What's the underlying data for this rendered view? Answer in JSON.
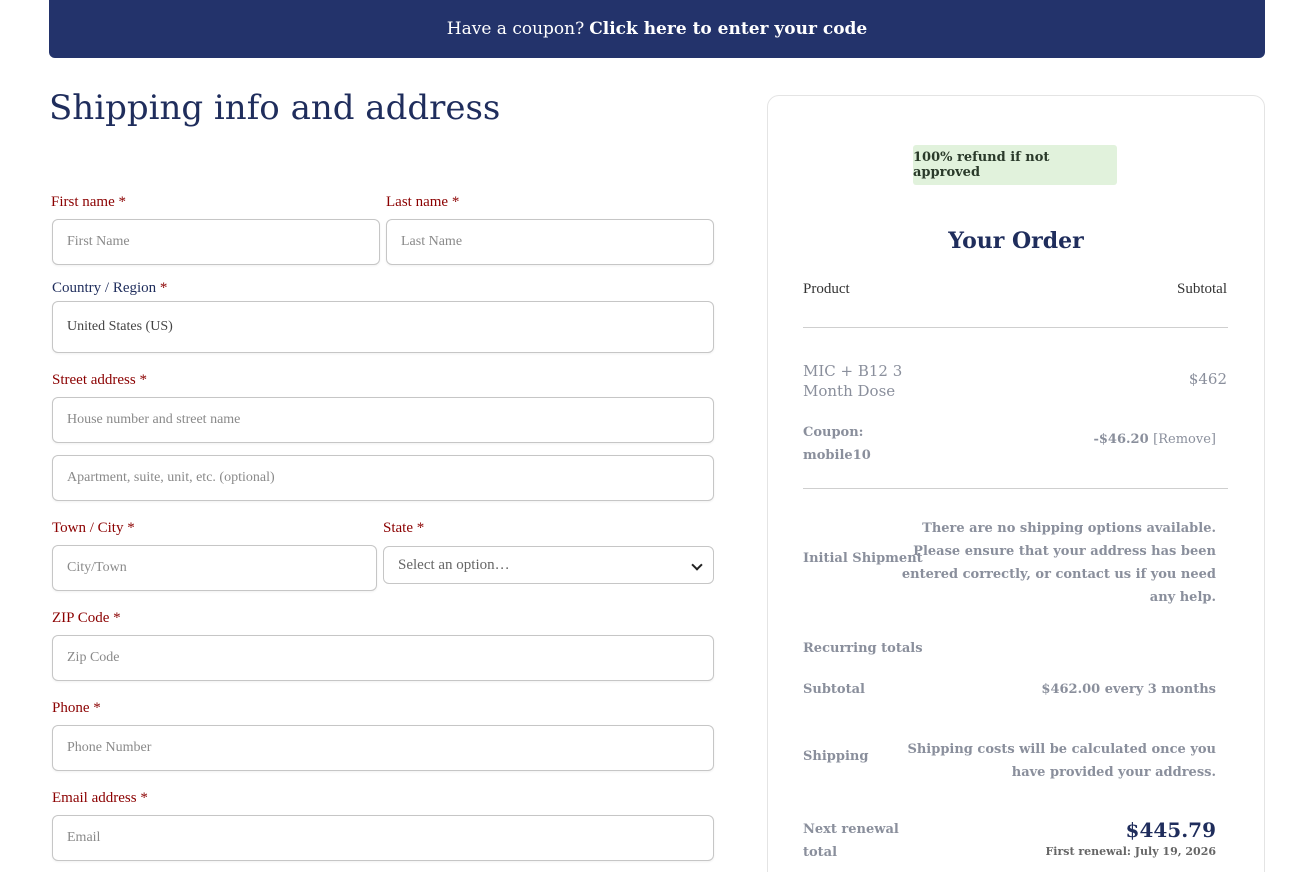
{
  "coupon": {
    "prompt": "Have a coupon?",
    "link": "Click here to enter your code"
  },
  "page": {
    "title": "Shipping info and address"
  },
  "form": {
    "first_name": {
      "label": "First name",
      "required": "*",
      "placeholder": "First Name"
    },
    "last_name": {
      "label": "Last name",
      "required": "*",
      "placeholder": "Last Name"
    },
    "country": {
      "label": "Country / Region",
      "required": "*",
      "value": "United States (US)"
    },
    "street": {
      "label": "Street address",
      "required": "*",
      "placeholder": "House number and street name"
    },
    "street2": {
      "placeholder": "Apartment, suite, unit, etc. (optional)"
    },
    "city": {
      "label": "Town / City",
      "required": "*",
      "placeholder": "City/Town"
    },
    "state": {
      "label": "State",
      "required": "*",
      "value": "Select an option…"
    },
    "zip": {
      "label": "ZIP Code",
      "required": "*",
      "placeholder": "Zip Code"
    },
    "phone": {
      "label": "Phone",
      "required": "*",
      "placeholder": "Phone Number"
    },
    "email": {
      "label": "Email address",
      "required": "*",
      "placeholder": "Email"
    }
  },
  "order": {
    "badge": "100% refund if not approved",
    "title": "Your Order",
    "col_product": "Product",
    "col_subtotal": "Subtotal",
    "item_name_line1": "MIC + B12 3",
    "item_name_line2": "Month Dose",
    "item_price": "$462",
    "coupon_label_line1": "Coupon:",
    "coupon_label_line2": "mobile10",
    "coupon_amount": "-$46.20",
    "coupon_remove": "[Remove]",
    "initial_shipment_label": "Initial Shipment",
    "initial_shipment_msg": [
      "There are no shipping options available.",
      "Please ensure that your address has been",
      "entered correctly, or contact us if you need",
      "any help."
    ],
    "recurring_label": "Recurring totals",
    "subtotal_label": "Subtotal",
    "subtotal_value": "$462.00 every 3 months",
    "shipping_label": "Shipping",
    "shipping_msg": [
      "Shipping costs will be calculated once you",
      "have provided your address."
    ],
    "renewal_label_line1": "Next renewal",
    "renewal_label_line2": "total",
    "renewal_amount": "$445.79",
    "renewal_date": "First renewal: July 19, 2026"
  },
  "colors": {
    "brand_navy": "#23336b",
    "required_red": "#8b0000",
    "badge_green": "#e1f2dc"
  }
}
